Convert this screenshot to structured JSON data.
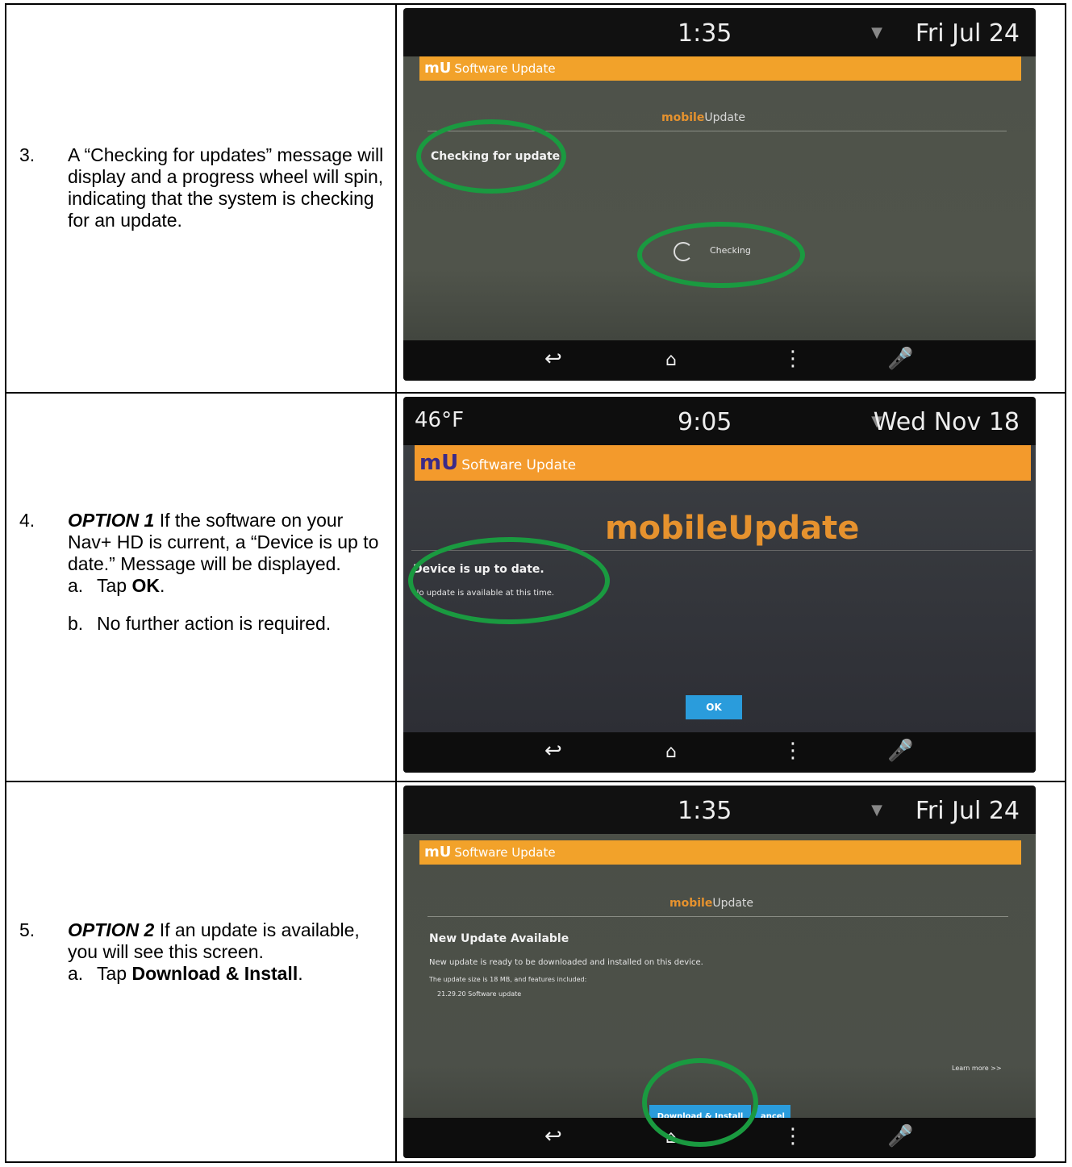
{
  "steps": [
    {
      "number": "3.",
      "text": "A “Checking for updates” message will display and a progress wheel will spin, indicating that the system is checking for an update."
    },
    {
      "number": "4.",
      "option_label": "OPTION 1",
      "text": " If the software on your Nav+ HD is current, a “Device is up to date.” Message will be displayed.",
      "sub": [
        {
          "num": "a.",
          "pre": "Tap ",
          "bold": "OK",
          "post": "."
        },
        {
          "num": "b.",
          "pre": "No further action is required.",
          "bold": "",
          "post": ""
        }
      ]
    },
    {
      "number": "5.",
      "option_label": "OPTION 2",
      "text": " If an update is available, you will see this screen.",
      "sub": [
        {
          "num": "a.",
          "pre": "Tap ",
          "bold": "Download & Install",
          "post": "."
        }
      ]
    }
  ],
  "screens": {
    "s1": {
      "time": "1:35",
      "date": "Fri Jul 24",
      "app_logo": "mU",
      "app_title": "Software Update",
      "brand_a": "mobile",
      "brand_b": "Update",
      "message": "Checking for update",
      "spinner_label": "Checking"
    },
    "s2": {
      "temp": "46°F",
      "time": "9:05",
      "date": "Wed Nov 18",
      "app_logo": "mU",
      "app_title": "Software Update",
      "brand_a": "mobile",
      "brand_b": "Update",
      "message": "Device is up to date.",
      "detail": "No update is available at this time.",
      "ok": "OK"
    },
    "s3": {
      "time": "1:35",
      "date": "Fri Jul 24",
      "app_logo": "mU",
      "app_title": "Software Update",
      "brand_a": "mobile",
      "brand_b": "Update",
      "heading": "New Update Available",
      "line1": "New update is ready to be downloaded and installed on this device.",
      "line2": "The update size is 18 MB, and features included:",
      "line3": "21.29.20 Software update",
      "learn_more": "Learn more >>",
      "download": "Download & Install",
      "cancel": "ancel"
    }
  },
  "icons": {
    "back": "back-arrow-icon",
    "home": "home-icon",
    "menu": "menu-dots-icon",
    "mic": "microphone-icon"
  },
  "colors": {
    "highlight_circle": "#1a9a40",
    "app_bar": "#f2a22a",
    "button_blue": "#2a9cdc",
    "brand_orange": "#e6922e"
  }
}
